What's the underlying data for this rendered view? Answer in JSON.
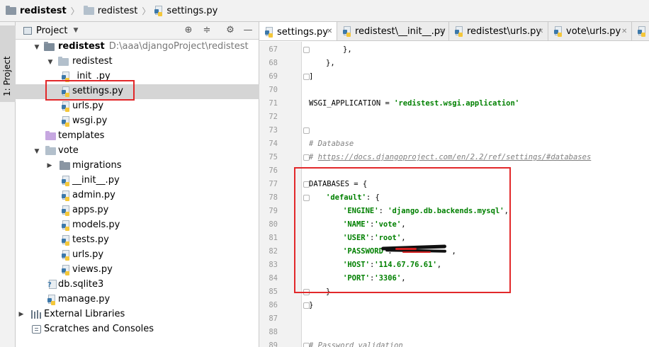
{
  "breadcrumb": {
    "project": "redistest",
    "folder": "redistest",
    "file": "settings.py"
  },
  "stripe": {
    "label": "1: Project"
  },
  "panel": {
    "title": "Project",
    "tree": [
      {
        "label": "redistest",
        "path": "D:\\aaa\\djangoProject\\redistest",
        "icon": "folder-icon"
      },
      {
        "label": "redistest",
        "icon": "folder-icon"
      },
      {
        "label": "_init_.py",
        "icon": "python-file-icon"
      },
      {
        "label": "settings.py",
        "icon": "python-file-icon"
      },
      {
        "label": "urls.py",
        "icon": "python-file-icon"
      },
      {
        "label": "wsgi.py",
        "icon": "python-file-icon"
      },
      {
        "label": "templates",
        "icon": "templates-folder-icon"
      },
      {
        "label": "vote",
        "icon": "folder-icon"
      },
      {
        "label": "migrations",
        "icon": "folder-icon"
      },
      {
        "label": "__init__.py",
        "icon": "python-file-icon"
      },
      {
        "label": "admin.py",
        "icon": "python-file-icon"
      },
      {
        "label": "apps.py",
        "icon": "python-file-icon"
      },
      {
        "label": "models.py",
        "icon": "python-file-icon"
      },
      {
        "label": "tests.py",
        "icon": "python-file-icon"
      },
      {
        "label": "urls.py",
        "icon": "python-file-icon"
      },
      {
        "label": "views.py",
        "icon": "python-file-icon"
      },
      {
        "label": "db.sqlite3",
        "icon": "database-file-icon"
      },
      {
        "label": "manage.py",
        "icon": "python-file-icon"
      },
      {
        "label": "External Libraries",
        "icon": "libraries-icon"
      },
      {
        "label": "Scratches and Consoles",
        "icon": "scratches-icon"
      }
    ]
  },
  "tabs": [
    {
      "label": "settings.py",
      "active": true
    },
    {
      "label": "redistest\\__init__.py",
      "active": false
    },
    {
      "label": "redistest\\urls.py",
      "active": false
    },
    {
      "label": "vote\\urls.py",
      "active": false
    }
  ],
  "code": {
    "line_numbers": [
      "67",
      "68",
      "69",
      "70",
      "71",
      "72",
      "73",
      "74",
      "75",
      "76",
      "77",
      "78",
      "79",
      "80",
      "81",
      "82",
      "83",
      "84",
      "85",
      "86",
      "87",
      "88",
      "89"
    ],
    "lines": {
      "l67": "},",
      "l68": "},",
      "l69": "]",
      "l71_a": "WSGI_APPLICATION = ",
      "l71_b": "'redistest.wsgi.application'",
      "l74": "# Database",
      "l75_a": "# ",
      "l75_b": "https://docs.djangoproject.com/en/2.2/ref/settings/#databases",
      "l77": "DATABASES = {",
      "l78_a": "'default'",
      "l78_b": ": {",
      "l79_a": "'ENGINE'",
      "l79_b": ": ",
      "l79_c": "'django.db.backends.mysql'",
      "l79_d": ",",
      "l80_a": "'NAME'",
      "l80_b": ":",
      "l80_c": "'vote'",
      "l80_d": ",",
      "l81_a": "'USER'",
      "l81_b": ":",
      "l81_c": "'root'",
      "l81_d": ",",
      "l82_a": "'PASSWORD'",
      "l82_b": ":",
      "l82_d": ",",
      "l83_a": "'HOST'",
      "l83_b": ":",
      "l83_c": "'114.67.76.61'",
      "l83_d": ",",
      "l84_a": "'PORT'",
      "l84_b": ":",
      "l84_c": "'3306'",
      "l84_d": ",",
      "l85": "}",
      "l86": "}",
      "l89": "# Password validation"
    }
  },
  "colors": {
    "highlight_box": "#e2282a",
    "string": "#008000",
    "comment": "#808080"
  }
}
